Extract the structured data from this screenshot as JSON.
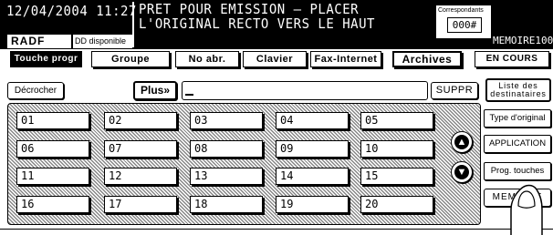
{
  "header": {
    "datetime": "12/04/2004 11:27",
    "message_line1": "PRET POUR EMISSION – PLACER",
    "message_line2": "L'ORIGINAL RECTO VERS LE HAUT",
    "feeder": "RADF",
    "dd_status": "DD disponible",
    "correspondants_label": "Correspondants",
    "correspondants_count": "000#",
    "memory_label": "MEMOIRE100"
  },
  "tabs": [
    {
      "label": "Touche progr",
      "active": true
    },
    {
      "label": "Groupe"
    },
    {
      "label": "No abr."
    },
    {
      "label": "Clavier"
    },
    {
      "label": "Fax-Internet"
    },
    {
      "label": "Archives"
    }
  ],
  "en_cours": "EN COURS",
  "row2": {
    "decrocher": "Décrocher",
    "plus": "Plus»",
    "entry_value": "",
    "suppr": "SUPPR",
    "liste_line1": "Liste des",
    "liste_line2": "destinataires"
  },
  "keys": [
    "01",
    "02",
    "03",
    "04",
    "05",
    "06",
    "07",
    "08",
    "09",
    "10",
    "11",
    "12",
    "13",
    "14",
    "15",
    "16",
    "17",
    "18",
    "19",
    "20"
  ],
  "side": {
    "type_original": "Type d'original",
    "application": "APPLICATION",
    "prog_touches": "Prog. touches",
    "memoire": "MEMOIRE"
  },
  "icons": {
    "scroll_up": "arrow-up-icon",
    "scroll_down": "arrow-down-icon",
    "finger": "finger-pointer-icon"
  },
  "colors": {
    "foreground": "#000000",
    "background": "#ffffff",
    "pattern": "#888888"
  }
}
